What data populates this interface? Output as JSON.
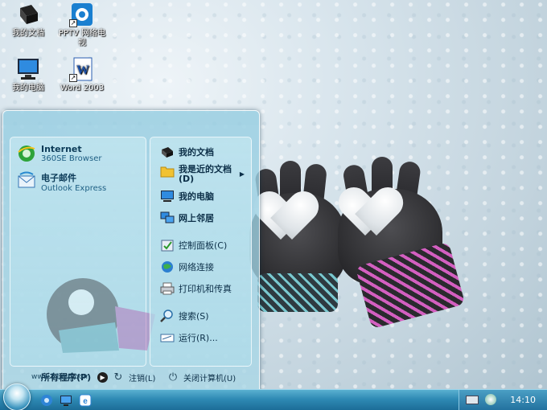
{
  "desktop": {
    "icons": [
      {
        "label": "我的文档",
        "icon": "documents-folder-icon"
      },
      {
        "label": "PPTV 网络电视",
        "icon": "pptv-icon"
      },
      {
        "label": "我的电脑",
        "icon": "computer-icon"
      },
      {
        "label": "Word 2003",
        "icon": "word-icon"
      }
    ]
  },
  "start_menu": {
    "pinned": [
      {
        "title": "Internet",
        "subtitle": "360SE Browser",
        "icon": "ie-browser-icon"
      },
      {
        "title": "电子邮件",
        "subtitle": "Outlook Express",
        "icon": "outlook-express-icon"
      }
    ],
    "all_programs": "所有程序(P)",
    "right_items": [
      {
        "label": "我的文档",
        "icon": "my-documents-icon"
      },
      {
        "label": "我是近的文档(D)",
        "icon": "recent-documents-icon"
      },
      {
        "label": "我的电脑",
        "icon": "my-computer-icon"
      },
      {
        "label": "网上邻居",
        "icon": "network-places-icon"
      },
      {
        "label": "控制面板(C)",
        "icon": "control-panel-icon"
      },
      {
        "label": "网络连接",
        "icon": "network-connections-icon"
      },
      {
        "label": "打印机和传真",
        "icon": "printer-fax-icon"
      },
      {
        "label": "搜索(S)",
        "icon": "search-icon"
      },
      {
        "label": "运行(R)...",
        "icon": "run-icon"
      }
    ],
    "website": "www.51ztzj.com",
    "logoff": "注销(L)",
    "shutdown": "关闭计算机(U)"
  },
  "taskbar": {
    "clock": "14:10"
  }
}
